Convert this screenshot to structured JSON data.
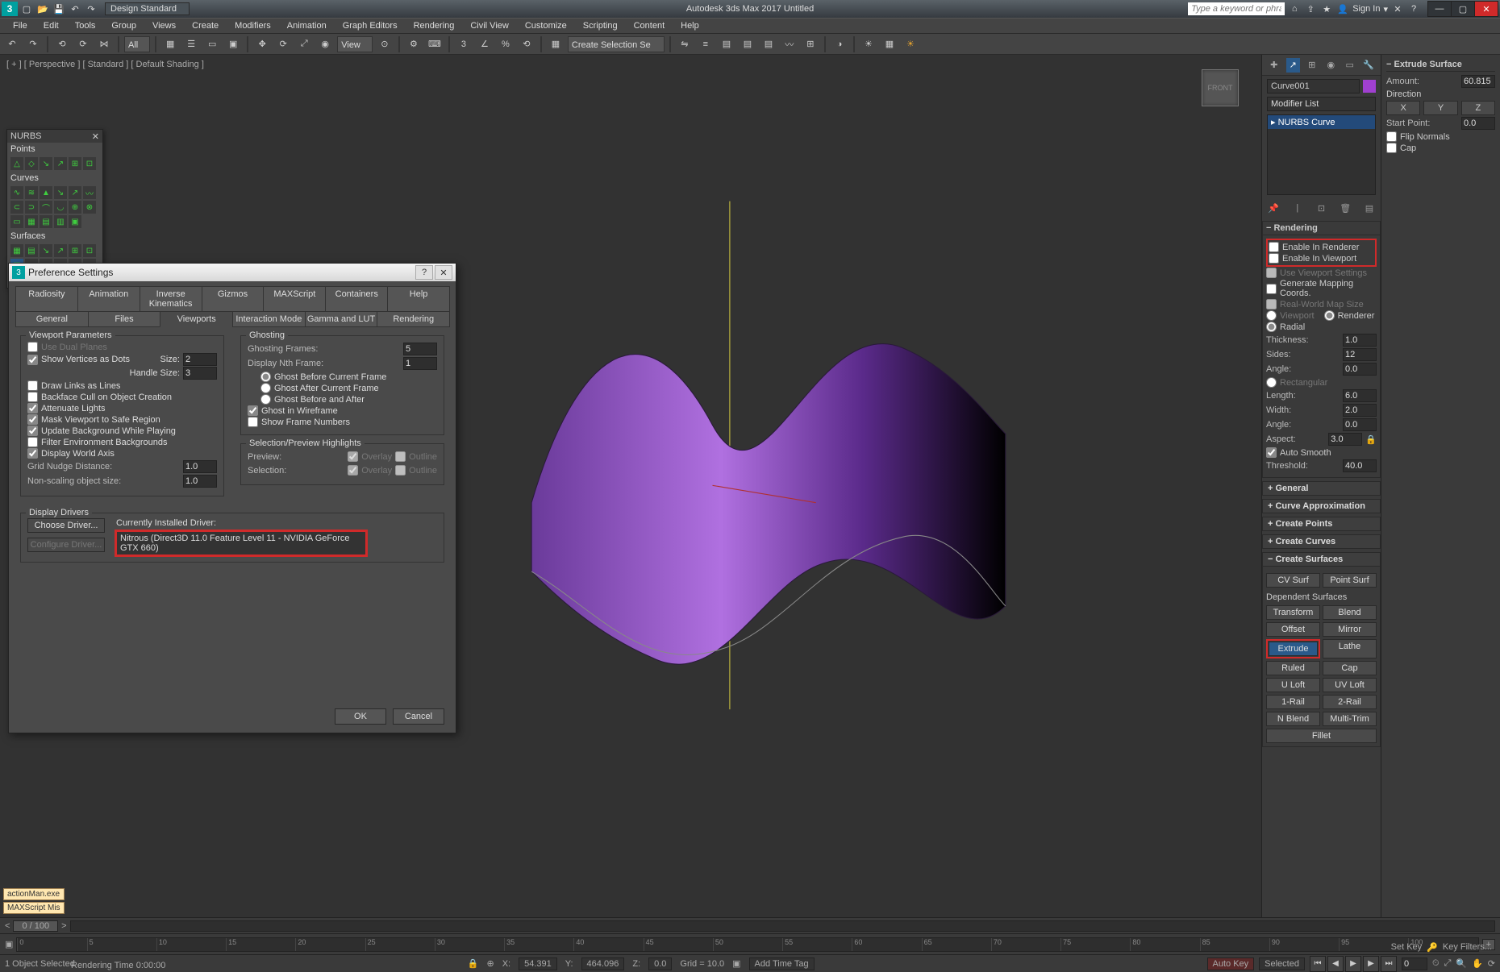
{
  "title": "Autodesk 3ds Max 2017   Untitled",
  "workspace": "Design Standard",
  "search_placeholder": "Type a keyword or phrase",
  "signin": "Sign In",
  "menus": [
    "File",
    "Edit",
    "Tools",
    "Group",
    "Views",
    "Create",
    "Modifiers",
    "Animation",
    "Graph Editors",
    "Rendering",
    "Civil View",
    "Customize",
    "Scripting",
    "Content",
    "Help"
  ],
  "toolbar": {
    "filter": "All",
    "ref": "View",
    "sel_set": "Create Selection Se"
  },
  "viewport": {
    "label": "[ + ] [ Perspective ] [ Standard ] [ Default Shading ]",
    "cube": "FRONT"
  },
  "nurbs": {
    "title": "NURBS",
    "sections": [
      "Points",
      "Curves",
      "Surfaces"
    ]
  },
  "modify": {
    "object_name": "Curve001",
    "modifier_list": "Modifier List",
    "stack_item": "NURBS Curve"
  },
  "extrude_panel": {
    "title": "Extrude Surface",
    "amount_label": "Amount:",
    "amount": "60.815",
    "direction": "Direction",
    "x": "X",
    "y": "Y",
    "z": "Z",
    "start_label": "Start Point:",
    "start": "0.0",
    "flip": "Flip Normals",
    "cap": "Cap"
  },
  "rollouts": {
    "rendering": {
      "title": "Rendering",
      "enable_renderer": "Enable In Renderer",
      "enable_viewport": "Enable In Viewport",
      "use_vp": "Use Viewport Settings",
      "gen_map": "Generate Mapping Coords.",
      "real_world": "Real-World Map Size",
      "viewport": "Viewport",
      "renderer": "Renderer",
      "radial": "Radial",
      "thickness_l": "Thickness:",
      "thickness": "1.0",
      "sides_l": "Sides:",
      "sides": "12",
      "angle_l": "Angle:",
      "angle": "0.0",
      "rectangular": "Rectangular",
      "length_l": "Length:",
      "length": "6.0",
      "width_l": "Width:",
      "width": "2.0",
      "angle2_l": "Angle:",
      "angle2": "0.0",
      "aspect_l": "Aspect:",
      "aspect": "3.0",
      "auto_smooth": "Auto Smooth",
      "threshold_l": "Threshold:",
      "threshold": "40.0"
    },
    "collapsed": [
      "General",
      "Curve Approximation",
      "Create Points",
      "Create Curves",
      "Create Surfaces"
    ],
    "surf_btns": {
      "cv": "CV Surf",
      "pt": "Point Surf",
      "dep": "Dependent Surfaces"
    },
    "dep_btns": [
      "Transform",
      "Blend",
      "Offset",
      "Mirror",
      "Extrude",
      "Lathe",
      "Ruled",
      "Cap",
      "U Loft",
      "UV Loft",
      "1-Rail",
      "2-Rail",
      "N Blend",
      "Multi-Trim",
      "Fillet"
    ]
  },
  "pref": {
    "title": "Preference Settings",
    "tabs_row1": [
      "Radiosity",
      "Animation",
      "Inverse Kinematics",
      "Gizmos",
      "MAXScript",
      "Containers",
      "Help"
    ],
    "tabs_row2": [
      "General",
      "Files",
      "Viewports",
      "Interaction Mode",
      "Gamma and LUT",
      "Rendering"
    ],
    "viewport_params": "Viewport Parameters",
    "use_dual": "Use Dual Planes",
    "show_verts": "Show Vertices as Dots",
    "size_l": "Size:",
    "size": "2",
    "handle_l": "Handle Size:",
    "handle": "3",
    "draw_links": "Draw Links as Lines",
    "backface": "Backface Cull on Object Creation",
    "attenuate": "Attenuate Lights",
    "mask_vp": "Mask Viewport to Safe Region",
    "update_bg": "Update Background While Playing",
    "filter_env": "Filter Environment Backgrounds",
    "disp_world": "Display World Axis",
    "grid_nudge_l": "Grid Nudge Distance:",
    "grid_nudge": "1.0",
    "nonscale_l": "Non-scaling object size:",
    "nonscale": "1.0",
    "ghosting": "Ghosting",
    "ghost_frames_l": "Ghosting Frames:",
    "ghost_frames": "5",
    "disp_nth_l": "Display Nth Frame:",
    "disp_nth": "1",
    "ghost_before": "Ghost Before Current Frame",
    "ghost_after": "Ghost After Current Frame",
    "ghost_both": "Ghost Before and After",
    "ghost_wire": "Ghost in Wireframe",
    "show_frame_num": "Show Frame Numbers",
    "sel_preview": "Selection/Preview Highlights",
    "preview_l": "Preview:",
    "selection_l": "Selection:",
    "overlay": "Overlay",
    "outline": "Outline",
    "display_drivers": "Display Drivers",
    "choose_driver": "Choose Driver...",
    "configure_driver": "Configure Driver...",
    "current_driver_l": "Currently Installed Driver:",
    "current_driver": "Nitrous (Direct3D 11.0 Feature Level 11 - NVIDIA GeForce GTX 660)",
    "ok": "OK",
    "cancel": "Cancel"
  },
  "timeline": {
    "frame_display": "0 / 100",
    "ticks": [
      "0",
      "5",
      "10",
      "15",
      "20",
      "25",
      "30",
      "35",
      "40",
      "45",
      "50",
      "55",
      "60",
      "65",
      "70",
      "75",
      "80",
      "85",
      "90",
      "95",
      "100"
    ]
  },
  "status": {
    "script_tags": [
      "actionMan.exe",
      "MAXScript Mis"
    ],
    "selected": "1 Object Selected",
    "render_time": "Rendering Time 0:00:00",
    "x_l": "X:",
    "x": "54.391",
    "y_l": "Y:",
    "y": "464.096",
    "z_l": "Z:",
    "z": "0.0",
    "grid": "Grid = 10.0",
    "add_time_tag": "Add Time Tag",
    "autokey": "Auto Key",
    "selected_mode": "Selected",
    "setkey": "Set Key",
    "keyfilters": "Key Filters...",
    "frame": "0"
  }
}
